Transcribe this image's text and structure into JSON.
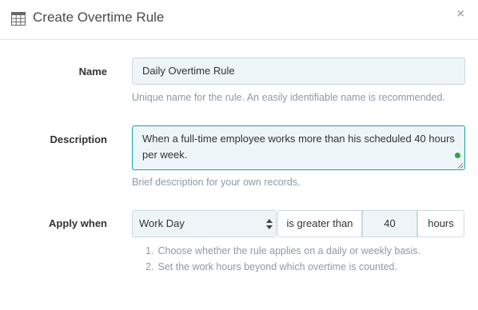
{
  "dialog": {
    "title": "Create Overtime Rule",
    "close_label": "×"
  },
  "form": {
    "name": {
      "label": "Name",
      "value": "Daily Overtime Rule",
      "help": "Unique name for the rule. An easily identifiable name is recommended."
    },
    "description": {
      "label": "Description",
      "value": "When a full-time employee works more than his scheduled 40 hours per week.",
      "help": "Brief description for your own records."
    },
    "apply_when": {
      "label": "Apply when",
      "selected": "Work Day",
      "comparator": "is greater than",
      "hours_value": "40",
      "unit": "hours",
      "steps": [
        {
          "num": "1.",
          "text": "Choose whether the rule applies on a daily or weekly basis."
        },
        {
          "num": "2.",
          "text": "Set the work hours beyond which overtime is counted."
        }
      ]
    }
  },
  "colors": {
    "accent": "#1aa1b4",
    "input_bg": "#eef5f8",
    "help_text": "#8c9aa3",
    "status_dot": "#27a844"
  },
  "icons": {
    "header": "calendar-grid-icon",
    "select": "sort-arrows-icon"
  }
}
